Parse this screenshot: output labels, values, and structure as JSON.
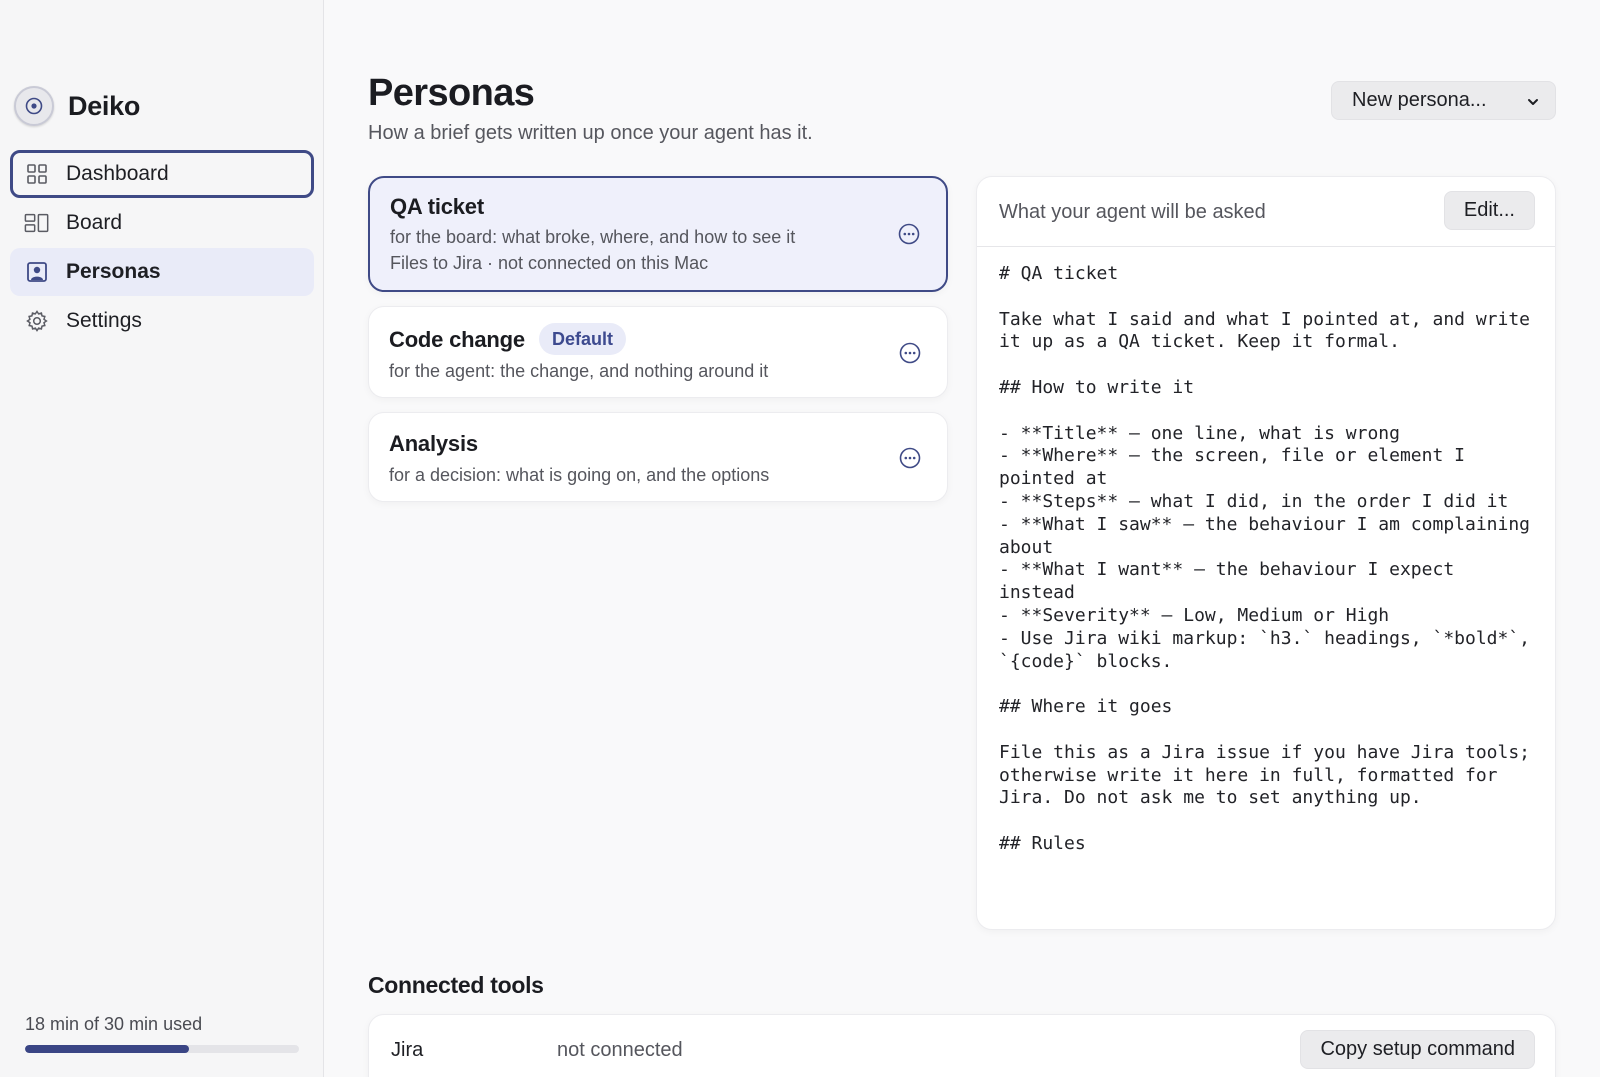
{
  "app": {
    "name": "Deiko"
  },
  "sidebar": {
    "items": [
      {
        "label": "Dashboard",
        "icon": "grid-icon"
      },
      {
        "label": "Board",
        "icon": "board-icon"
      },
      {
        "label": "Personas",
        "icon": "person-icon"
      },
      {
        "label": "Settings",
        "icon": "gear-icon"
      }
    ],
    "active": "Personas",
    "focused": "Dashboard",
    "usage": {
      "text": "18 min of 30 min used",
      "used": 18,
      "total": 30
    }
  },
  "header": {
    "title": "Personas",
    "subtitle": "How a brief gets written up once your agent has it.",
    "new_persona_label": "New persona..."
  },
  "personas": [
    {
      "title": "QA ticket",
      "line1": "for the board: what broke, where, and how to see it",
      "line2": "Files to Jira · not connected on this Mac",
      "selected": true
    },
    {
      "title": "Code change",
      "badge": "Default",
      "line1": "for the agent: the change, and nothing around it"
    },
    {
      "title": "Analysis",
      "line1": "for a decision: what is going on, and the options"
    }
  ],
  "prompt": {
    "label": "What your agent will be asked",
    "edit_label": "Edit...",
    "body": "# QA ticket\n\nTake what I said and what I pointed at, and write it up as a QA ticket. Keep it formal.\n\n## How to write it\n\n- **Title** — one line, what is wrong\n- **Where** — the screen, file or element I pointed at\n- **Steps** — what I did, in the order I did it\n- **What I saw** — the behaviour I am complaining about\n- **What I want** — the behaviour I expect instead\n- **Severity** — Low, Medium or High\n- Use Jira wiki markup: `h3.` headings, `*bold*`, `{code}` blocks.\n\n## Where it goes\n\nFile this as a Jira issue if you have Jira tools; otherwise write it here in full, formatted for Jira. Do not ask me to set anything up.\n\n## Rules"
  },
  "tools": {
    "heading": "Connected tools",
    "items": [
      {
        "name": "Jira",
        "status": "not connected",
        "action": "Copy setup command"
      }
    ]
  },
  "colors": {
    "accent": "#3f4a86",
    "active_bg": "#e9ebf8",
    "badge_text": "#3d4a8f"
  }
}
